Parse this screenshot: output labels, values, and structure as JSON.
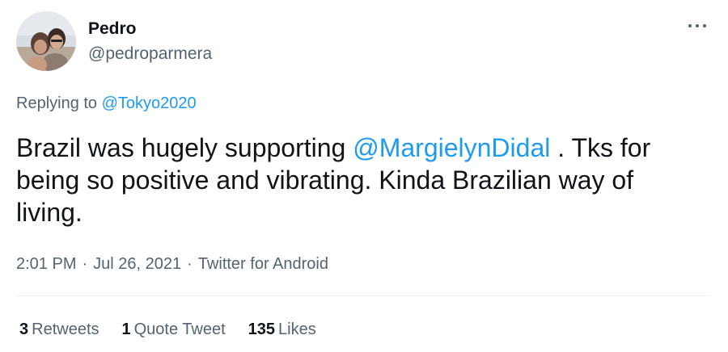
{
  "author": {
    "name": "Pedro",
    "handle": "@pedroparmera",
    "avatar_icon": "profile-photo"
  },
  "reply": {
    "prefix": "Replying to",
    "target": "@Tokyo2020"
  },
  "tweet": {
    "text_before": "Brazil was hugely supporting ",
    "mention": "@MargielynDidal",
    "text_after": " . Tks for being so positive and vibrating. Kinda Brazilian way of living."
  },
  "meta": {
    "time": "2:01 PM",
    "separator": "·",
    "date": "Jul 26, 2021",
    "source": "Twitter for Android"
  },
  "stats": {
    "retweets_count": "3",
    "retweets_label": "Retweets",
    "quotes_count": "1",
    "quotes_label": "Quote Tweet",
    "likes_count": "135",
    "likes_label": "Likes"
  },
  "more_icon": "more-horizontal-icon",
  "colors": {
    "link": "#1d9bf0",
    "secondary_text": "#536471",
    "primary_text": "#0f1419"
  }
}
